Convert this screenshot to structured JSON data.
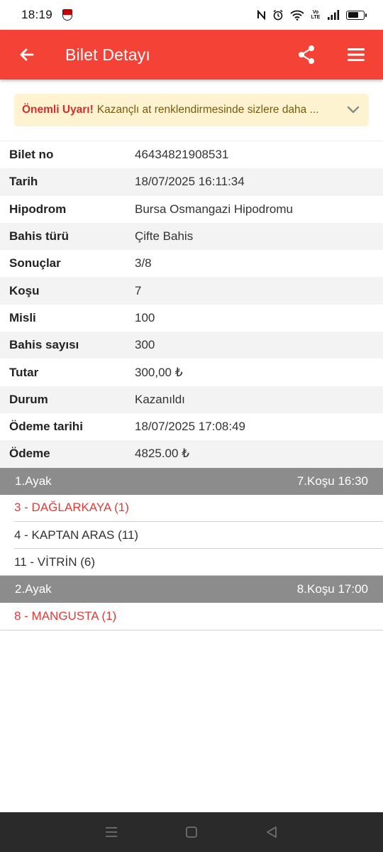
{
  "status_bar": {
    "time": "18:19",
    "icons": [
      "club-badge-icon",
      "nfc-icon",
      "alarm-icon",
      "wifi-icon",
      "volte-icon",
      "signal-icon",
      "battery-icon"
    ],
    "volte": "Vo LTE",
    "battery_level": 0.7
  },
  "app_bar": {
    "title": "Bilet Detayı",
    "color": "#f44336",
    "icons": [
      "back-arrow-icon",
      "share-icon",
      "menu-icon"
    ]
  },
  "warning": {
    "strong": "Önemli Uyarı!",
    "text": "Kazançlı at renklendirmesinde sizlere daha ...",
    "background": "#fdf3d0"
  },
  "details": [
    {
      "label": "Bilet no",
      "value": "46434821908531"
    },
    {
      "label": "Tarih",
      "value": "18/07/2025 16:11:34"
    },
    {
      "label": "Hipodrom",
      "value": "Bursa Osmangazi Hipodromu"
    },
    {
      "label": "Bahis türü",
      "value": "Çifte Bahis"
    },
    {
      "label": "Sonuçlar",
      "value": "3/8"
    },
    {
      "label": "Koşu",
      "value": "7"
    },
    {
      "label": "Misli",
      "value": "100"
    },
    {
      "label": "Bahis sayısı",
      "value": "300"
    },
    {
      "label": "Tutar",
      "value": "300,00 ₺"
    },
    {
      "label": "Durum",
      "value": "Kazanıldı"
    },
    {
      "label": "Ödeme tarihi",
      "value": "18/07/2025 17:08:49"
    },
    {
      "label": "Ödeme",
      "value": "4825.00 ₺"
    }
  ],
  "legs": [
    {
      "name": "1.Ayak",
      "race": "7.Koşu 16:30",
      "runners": [
        {
          "text": "3 - DAĞLARKAYA (1)",
          "winner": true
        },
        {
          "text": "4 - KAPTAN ARAS (11)",
          "winner": false
        },
        {
          "text": "11 - VİTRİN (6)",
          "winner": false
        }
      ]
    },
    {
      "name": "2.Ayak",
      "race": "8.Koşu 17:00",
      "runners": [
        {
          "text": "8 - MANGUSTA (1)",
          "winner": true
        }
      ]
    }
  ],
  "nav_bar": {
    "icons": [
      "recents-icon",
      "home-icon",
      "back-triangle-icon"
    ]
  }
}
